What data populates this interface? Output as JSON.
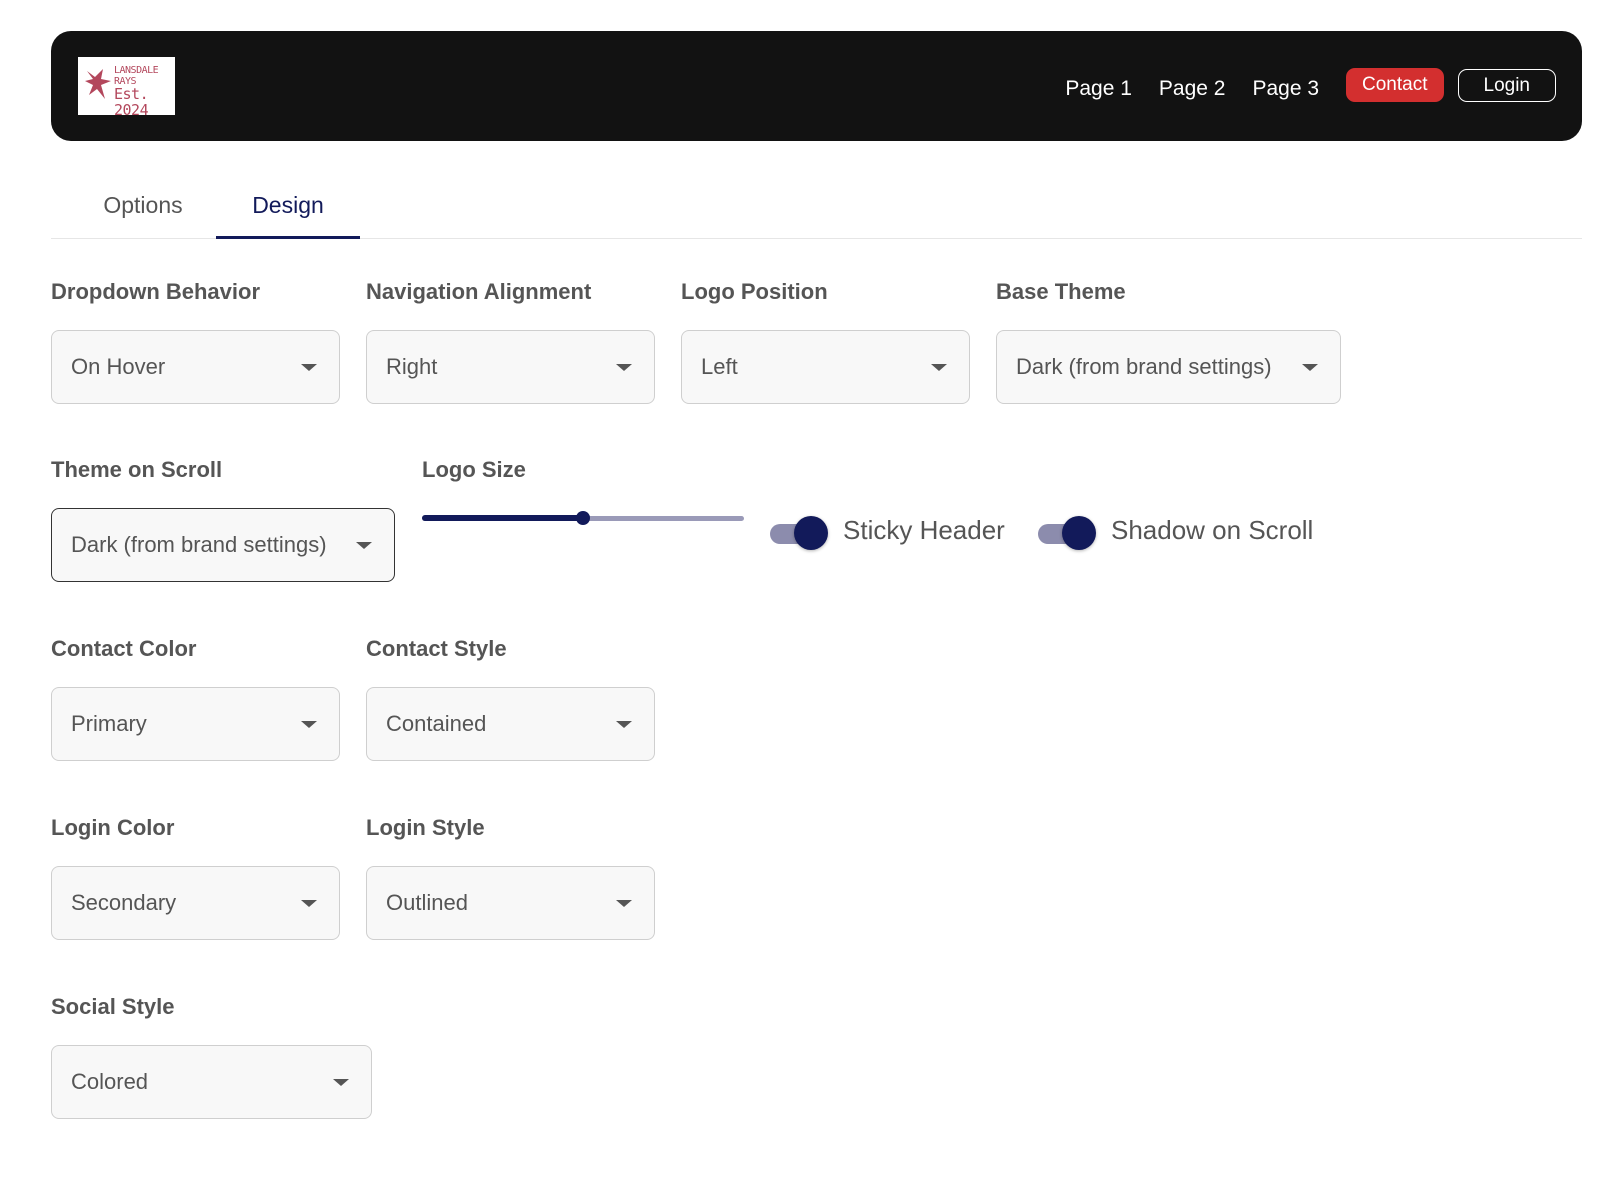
{
  "header": {
    "logo": {
      "line1": "LANSDALE RAYS",
      "line2": "Est. 2024"
    },
    "nav_links": [
      "Page 1",
      "Page 2",
      "Page 3"
    ],
    "contact_label": "Contact",
    "login_label": "Login"
  },
  "tabs": [
    {
      "label": "Options",
      "active": false
    },
    {
      "label": "Design",
      "active": true
    }
  ],
  "fields": {
    "dropdown_behavior": {
      "label": "Dropdown Behavior",
      "value": "On Hover"
    },
    "navigation_alignment": {
      "label": "Navigation Alignment",
      "value": "Right"
    },
    "logo_position": {
      "label": "Logo Position",
      "value": "Left"
    },
    "base_theme": {
      "label": "Base Theme",
      "value": "Dark (from brand settings)"
    },
    "theme_on_scroll": {
      "label": "Theme on Scroll",
      "value": "Dark (from brand settings)"
    },
    "logo_size": {
      "label": "Logo Size",
      "value_fraction": 0.5
    },
    "sticky_header": {
      "label": "Sticky Header",
      "on": true
    },
    "shadow_on_scroll": {
      "label": "Shadow on Scroll",
      "on": true
    },
    "contact_color": {
      "label": "Contact Color",
      "value": "Primary"
    },
    "contact_style": {
      "label": "Contact Style",
      "value": "Contained"
    },
    "login_color": {
      "label": "Login Color",
      "value": "Secondary"
    },
    "login_style": {
      "label": "Login Style",
      "value": "Outlined"
    },
    "social_style": {
      "label": "Social Style",
      "value": "Colored"
    }
  },
  "icons": {
    "select_caret": "caret-down-icon",
    "logo": "ray-fish-icon"
  },
  "colors": {
    "header_bg": "#121212",
    "contact_button": "#d32f2f",
    "accent": "#121a5a",
    "logo": "#b3475c"
  }
}
